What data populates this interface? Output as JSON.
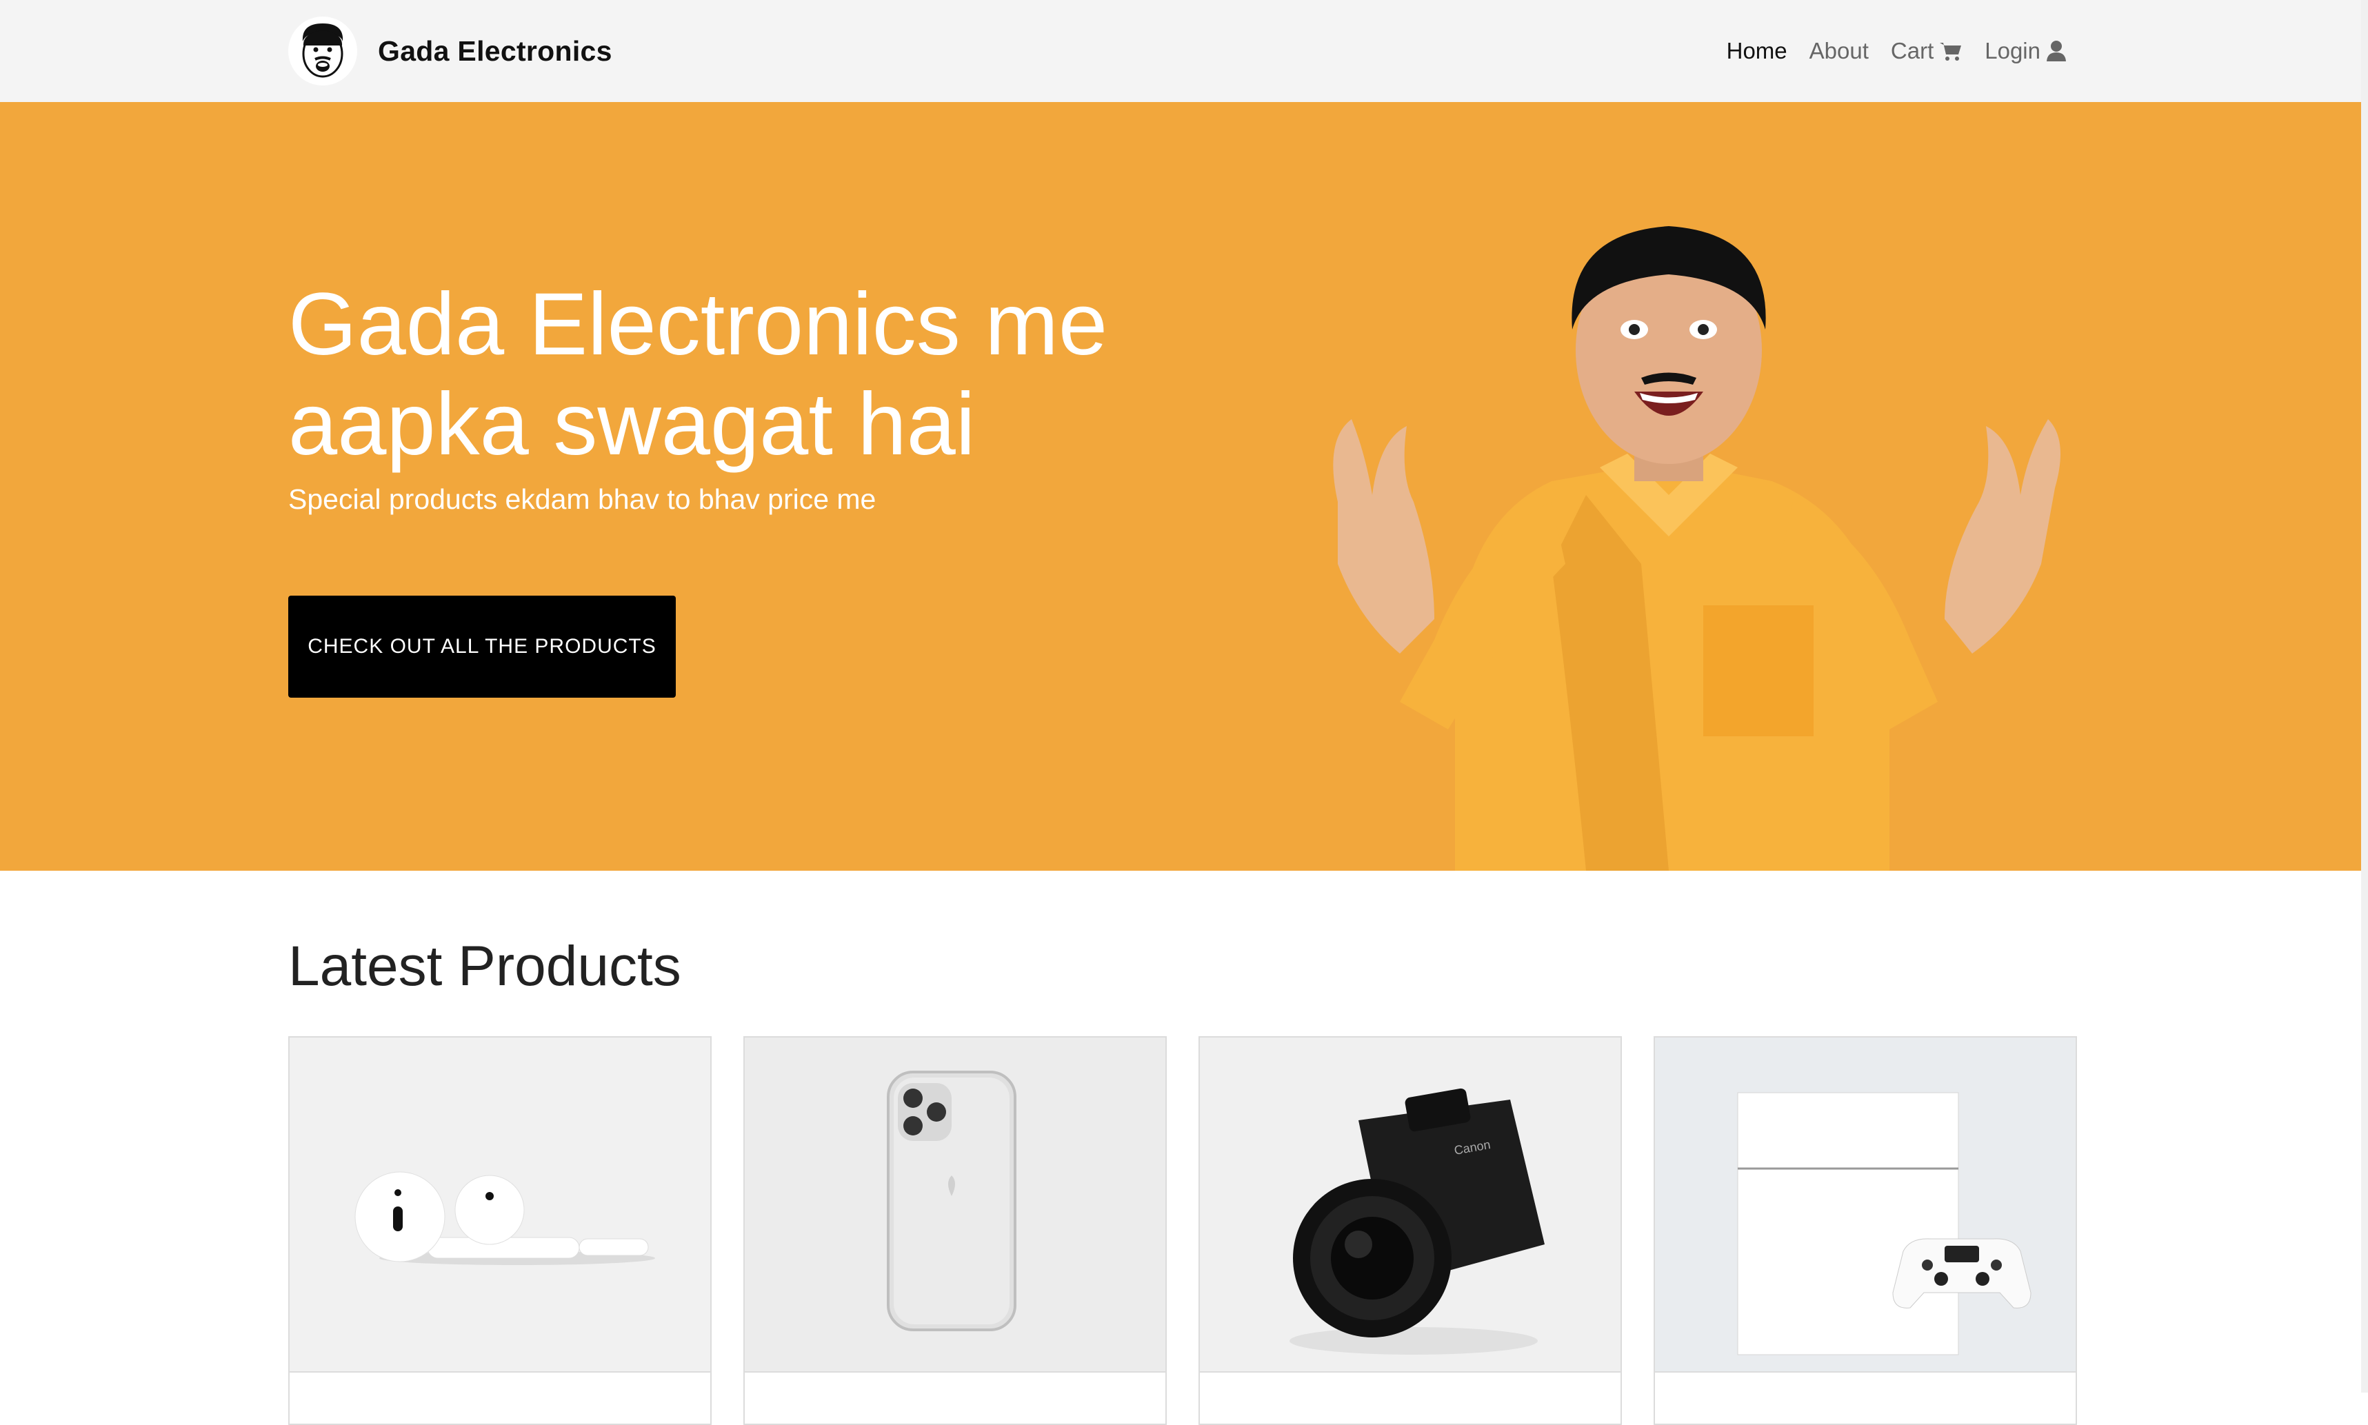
{
  "navbar": {
    "brand_name": "Gada Electronics",
    "logo_icon": "cartoon-face-logo",
    "links": [
      {
        "label": "Home",
        "active": true
      },
      {
        "label": "About",
        "active": false
      },
      {
        "label": "Cart",
        "icon": "cart-icon",
        "active": false
      },
      {
        "label": "Login",
        "icon": "user-icon",
        "active": false
      }
    ]
  },
  "hero": {
    "title": "Gada Electronics me aapka swagat hai",
    "subtitle": "Special products ekdam bhav to bhav price me",
    "cta_label": "CHECK OUT ALL THE PRODUCTS",
    "background_color": "#f2a73c"
  },
  "products": {
    "heading": "Latest Products",
    "items": [
      {
        "image": "airpods-image"
      },
      {
        "image": "iphone-image"
      },
      {
        "image": "camera-image"
      },
      {
        "image": "playstation-image"
      }
    ]
  }
}
